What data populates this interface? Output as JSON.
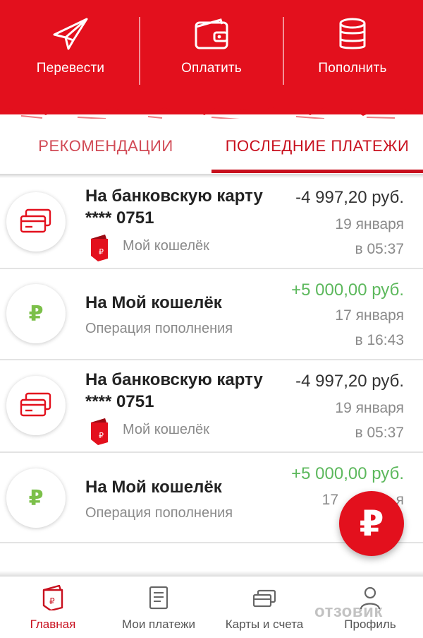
{
  "header": {
    "actions": [
      {
        "label": "Перевести",
        "icon": "paper-plane-icon"
      },
      {
        "label": "Оплатить",
        "icon": "wallet-icon"
      },
      {
        "label": "Пополнить",
        "icon": "coins-stack-icon"
      }
    ],
    "brand_color": "#e3101d"
  },
  "tabs": [
    {
      "label": "РЕКОМЕНДАЦИИ",
      "active": false
    },
    {
      "label": "ПОСЛЕДНИЕ ПЛАТЕЖИ",
      "active": true
    }
  ],
  "transactions": [
    {
      "title": "На банковскую карту **** 0751",
      "subtitle": "Мой кошелёк",
      "amount": "-4 997,20 руб.",
      "date": "19 января",
      "time": "в 05:37",
      "type": "card-transfer"
    },
    {
      "title": "На Мой кошелёк",
      "subtitle": "Операция пополнения",
      "amount": "+5 000,00 руб.",
      "date": "17 января",
      "time": "в 16:43",
      "type": "top-up"
    },
    {
      "title": "На банковскую карту **** 0751",
      "subtitle": "Мой кошелёк",
      "amount": "-4 997,20 руб.",
      "date": "19 января",
      "time": "в 05:37",
      "type": "card-transfer"
    },
    {
      "title": "На Мой кошелёк",
      "subtitle": "Операция пополнения",
      "amount": "+5 000,00 руб.",
      "date": "17",
      "time": "я",
      "type": "top-up"
    }
  ],
  "fab": {
    "label": "₽"
  },
  "bottom_nav": [
    {
      "label": "Главная",
      "icon": "wallet-logo-icon",
      "active": true
    },
    {
      "label": "Мои платежи",
      "icon": "receipt-icon",
      "active": false
    },
    {
      "label": "Карты и счета",
      "icon": "cards-icon",
      "active": false
    },
    {
      "label": "Профиль",
      "icon": "person-icon",
      "active": false
    }
  ],
  "watermark": "отзовик",
  "colors": {
    "negative": "#333333",
    "positive": "#5cb85c",
    "accent": "#c8101e",
    "muted": "#8a8a8a"
  }
}
